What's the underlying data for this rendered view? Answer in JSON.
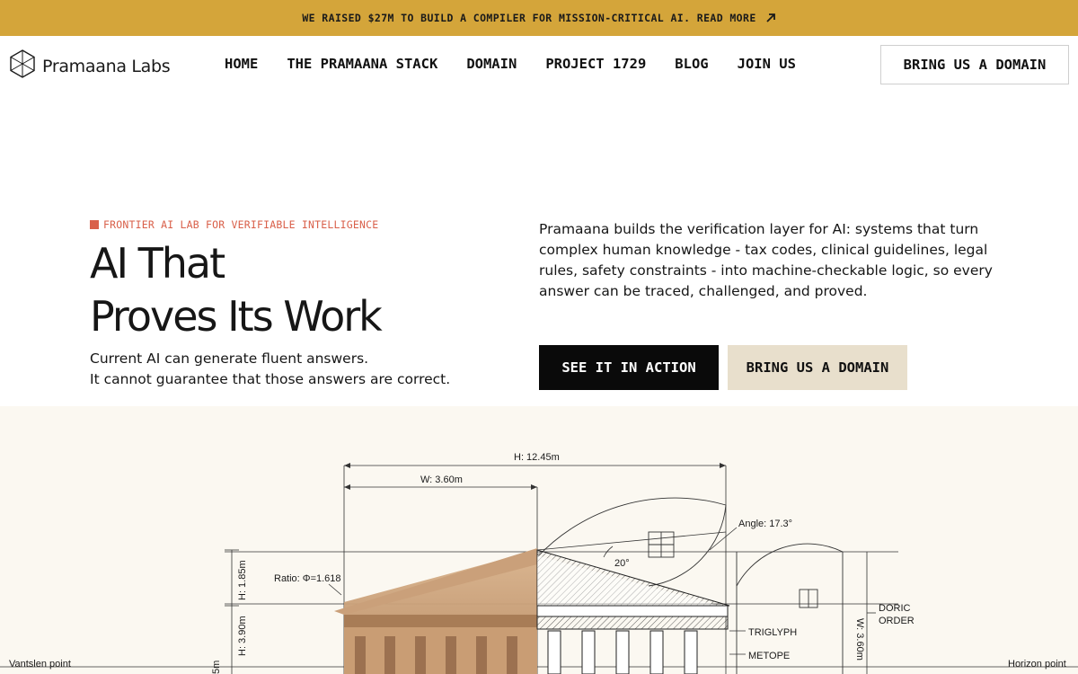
{
  "announcement": {
    "text": "WE RAISED $27M TO BUILD A COMPILER FOR MISSION-CRITICAL AI. READ MORE",
    "icon": "arrow-up-right-icon"
  },
  "brand": {
    "name": "Pramaana Labs",
    "icon": "hexagon-cube-logo"
  },
  "nav": {
    "links": [
      "HOME",
      "THE PRAMAANA STACK",
      "DOMAIN",
      "PROJECT 1729",
      "BLOG",
      "JOIN US"
    ],
    "cta": "BRING US A DOMAIN"
  },
  "hero": {
    "eyebrow": "FRONTIER AI LAB FOR VERIFIABLE INTELLIGENCE",
    "headline_line1": "AI That",
    "headline_line2": "Proves Its Work",
    "sub_line1": "Current AI can generate fluent answers.",
    "sub_line2": "It cannot guarantee that those answers are correct.",
    "intro": "Pramaana builds the verification layer for AI: systems that turn complex human knowledge - tax codes, clinical guidelines, legal rules, safety constraints - into machine-checkable logic, so every answer can be traced, challenged, and proved.",
    "primary_button": "SEE IT IN ACTION",
    "secondary_button": "BRING US A DOMAIN"
  },
  "blueprint": {
    "labels": {
      "height_total": "H: 12.45m",
      "width": "W: 3.60m",
      "angle": "Angle: 17.3°",
      "angle_small": "20°",
      "ratio": "Ratio: Φ=1.618",
      "height_185": "H: 1.85m",
      "height_390": "H: 3.90m",
      "doric": "DORIC",
      "order": "ORDER",
      "triglyph": "TRIGLYPH",
      "metope": "METOPE",
      "width_side": "W: 3.60m",
      "vanishing": "Vantslen point",
      "horizon": "Horizon point",
      "left_edge": "5m"
    }
  },
  "colors": {
    "announcement_bg": "#d4a53a",
    "eyebrow": "#d9604a",
    "primary_btn": "#0a0a0a",
    "secondary_btn": "#e8dfcc"
  }
}
